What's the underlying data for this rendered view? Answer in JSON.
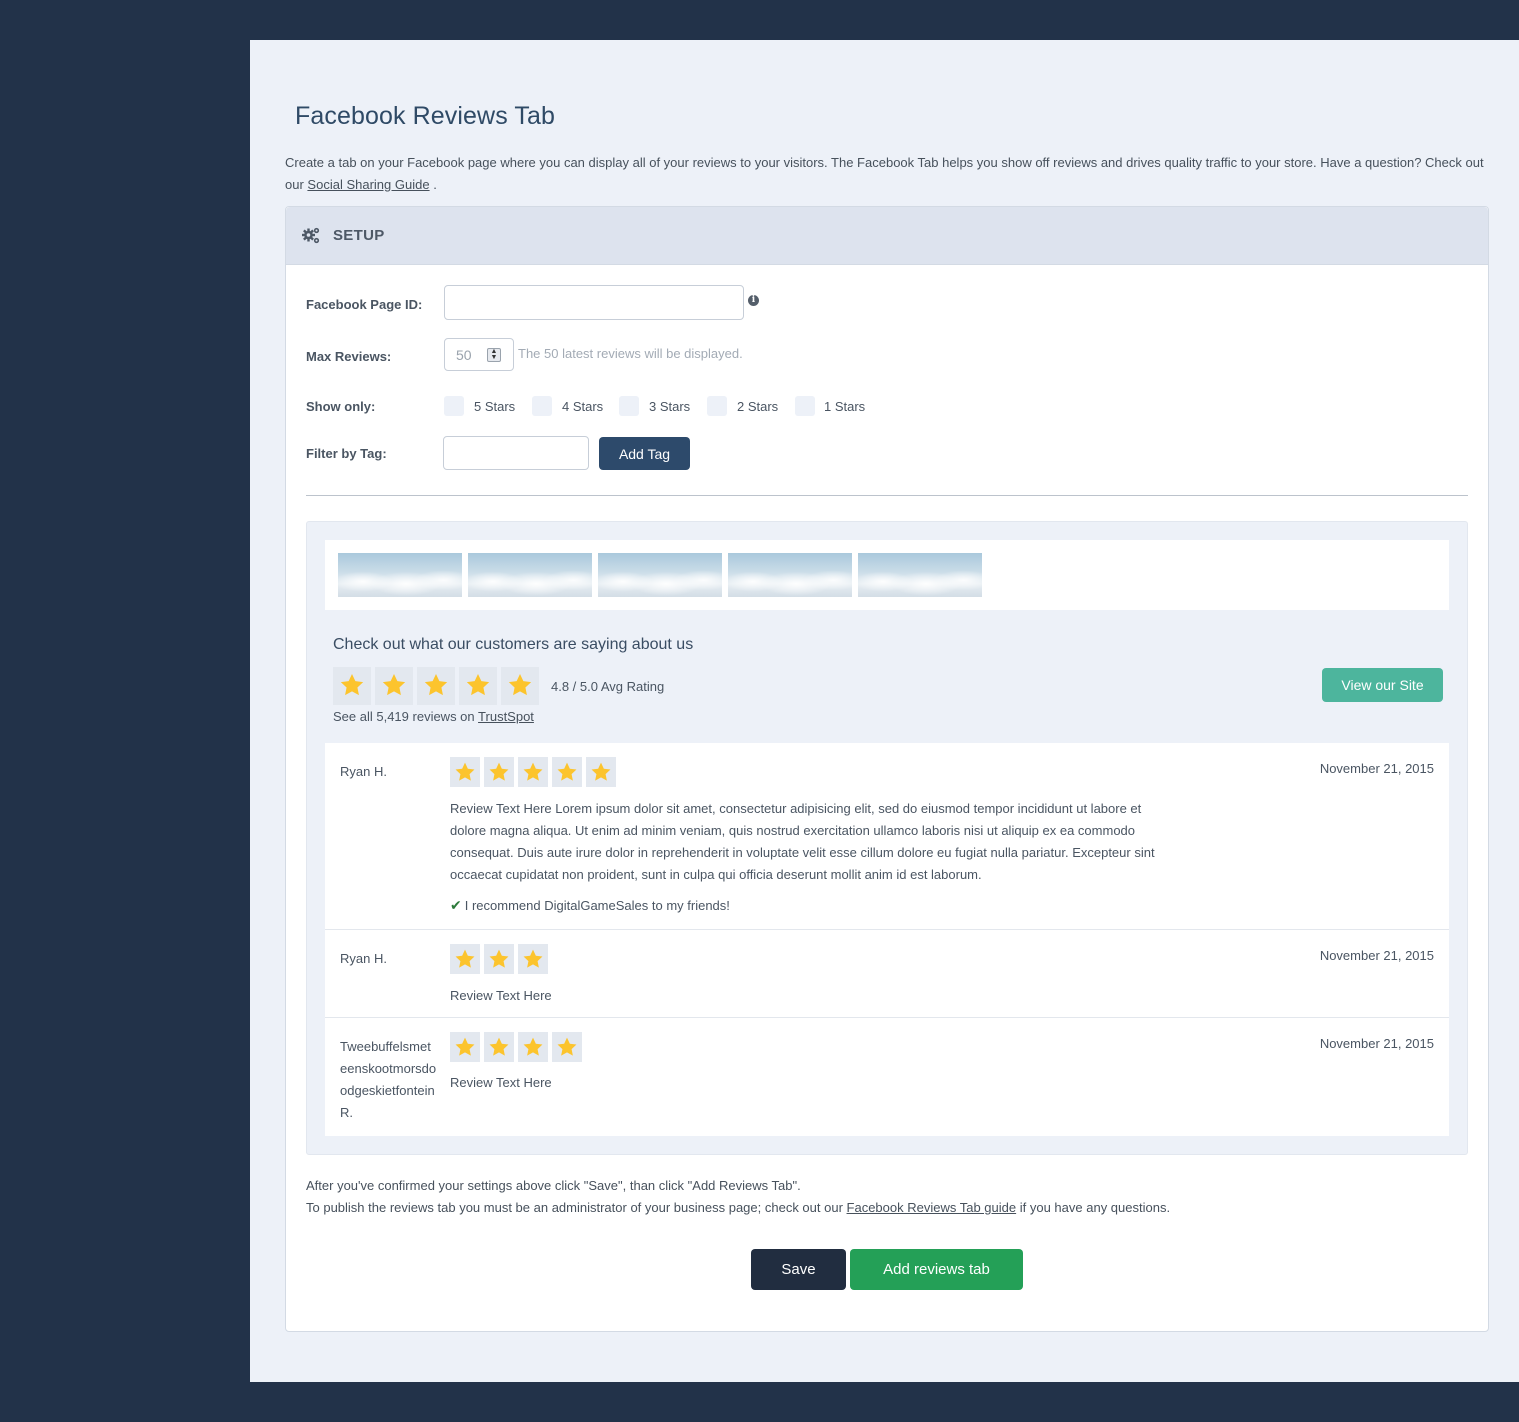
{
  "page": {
    "title": "Facebook Reviews Tab",
    "intro_text": "Create a tab on your Facebook page where you can display all of your reviews to your visitors. The Facebook Tab helps you show off reviews and drives quality traffic to your store. Have a question? Check out our",
    "intro_link": "Social Sharing Guide",
    "intro_end": "."
  },
  "setup": {
    "header": "SETUP",
    "page_id_label": "Facebook Page ID:",
    "page_id_value": "",
    "max_reviews_label": "Max Reviews:",
    "max_reviews_value": "50",
    "max_reviews_hint": "The 50 latest reviews will be displayed.",
    "show_only_label": "Show only:",
    "star_filters": [
      {
        "label": "5 Stars",
        "checked": false
      },
      {
        "label": "4 Stars",
        "checked": false
      },
      {
        "label": "3 Stars",
        "checked": false
      },
      {
        "label": "2 Stars",
        "checked": false
      },
      {
        "label": "1 Stars",
        "checked": false
      }
    ],
    "filter_tag_label": "Filter by Tag:",
    "filter_tag_value": "",
    "add_tag_button": "Add Tag"
  },
  "preview": {
    "summary_title": "Check out what our customers are saying about us",
    "avg_rating_text": "4.8 / 5.0 Avg Rating",
    "avg_stars": 5,
    "reviews_link_prefix": "See all 5,419 reviews on",
    "reviews_link": "TrustSpot",
    "view_site_button": "View our Site",
    "reviews": [
      {
        "name": "Ryan H.",
        "date": "November 21, 2015",
        "stars": 5,
        "text": "Review Text Here Lorem ipsum dolor sit amet, consectetur adipisicing elit, sed do eiusmod tempor incididunt ut labore et dolore magna aliqua. Ut enim ad minim veniam, quis nostrud exercitation ullamco laboris nisi ut aliquip ex ea commodo consequat. Duis aute irure dolor in reprehenderit in voluptate velit esse cillum dolore eu fugiat nulla pariatur. Excepteur sint occaecat cupidatat non proident, sunt in culpa qui officia deserunt mollit anim id est laborum.",
        "recommend": "I recommend DigitalGameSales to my friends!"
      },
      {
        "name": "Ryan H.",
        "date": "November 21, 2015",
        "stars": 3,
        "text": "Review Text Here"
      },
      {
        "name": "Tweebuffelsmeteenskootmorsdoodgeskietfontein R.",
        "date": "November 21, 2015",
        "stars": 4,
        "text": "Review Text Here"
      }
    ]
  },
  "footer": {
    "line1": "After you've confirmed your settings above click \"Save\", than click \"Add Reviews Tab\".",
    "line2_prefix": "To publish the reviews tab you must be an administrator of your business page; check out our",
    "line2_link": "Facebook Reviews Tab guide",
    "line2_suffix": "if you have any questions.",
    "save_button": "Save",
    "add_tab_button": "Add reviews tab"
  },
  "colors": {
    "sidebar_bg": "#223249",
    "star_gold": "#fcc42d",
    "accent_teal": "#4db59d",
    "accent_green": "#24a057",
    "primary_navy": "#2d4a6b"
  }
}
